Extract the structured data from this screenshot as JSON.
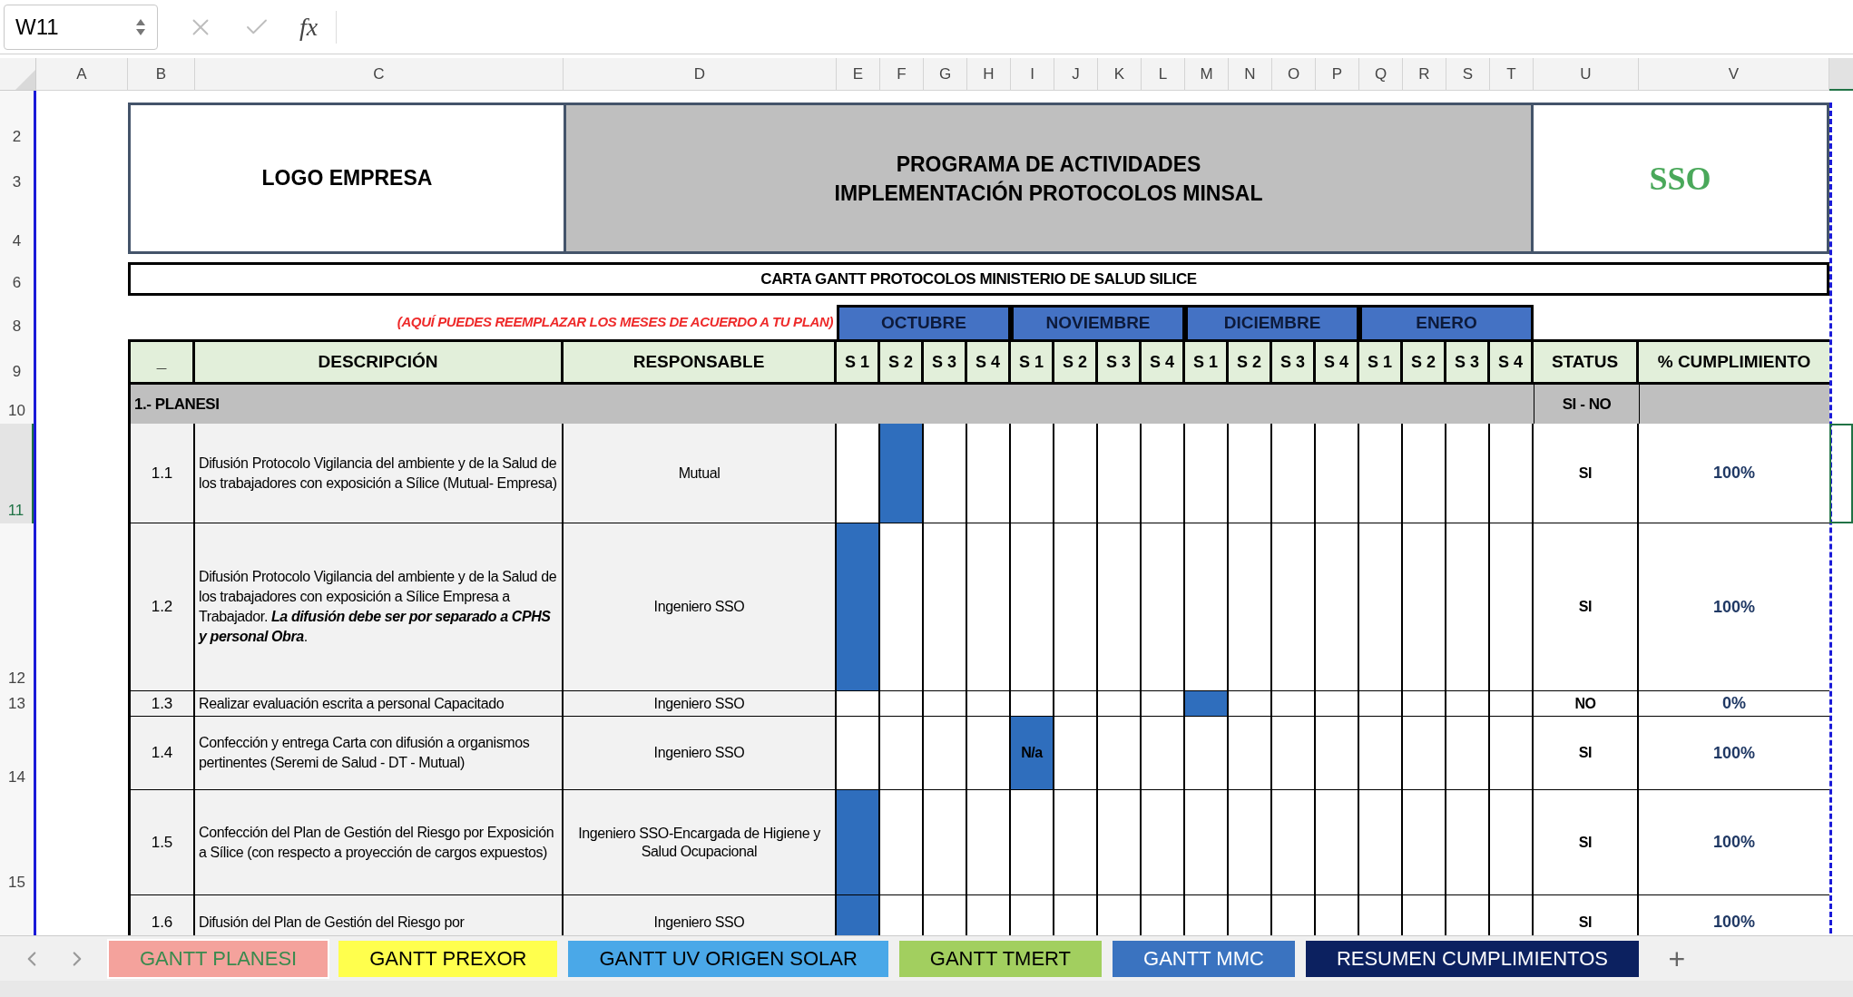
{
  "formula_bar": {
    "name_box": "W11",
    "function_label": "fx"
  },
  "columns": [
    {
      "label": "A"
    },
    {
      "label": "B"
    },
    {
      "label": "C"
    },
    {
      "label": "D"
    },
    {
      "label": "E"
    },
    {
      "label": "F"
    },
    {
      "label": "G"
    },
    {
      "label": "H"
    },
    {
      "label": "I"
    },
    {
      "label": "J"
    },
    {
      "label": "K"
    },
    {
      "label": "L"
    },
    {
      "label": "M"
    },
    {
      "label": "N"
    },
    {
      "label": "O"
    },
    {
      "label": "P"
    },
    {
      "label": "Q"
    },
    {
      "label": "R"
    },
    {
      "label": "S"
    },
    {
      "label": "T"
    },
    {
      "label": "U"
    },
    {
      "label": "V"
    }
  ],
  "row_headers": [
    {
      "label": "2",
      "selected": false
    },
    {
      "label": "3",
      "selected": false
    },
    {
      "label": "4",
      "selected": false
    },
    {
      "label": "6",
      "selected": false
    },
    {
      "label": "8",
      "selected": false
    },
    {
      "label": "9",
      "selected": false
    },
    {
      "label": "10",
      "selected": false
    },
    {
      "label": "11",
      "selected": true
    },
    {
      "label": "12",
      "selected": false
    },
    {
      "label": "13",
      "selected": false
    },
    {
      "label": "14",
      "selected": false
    },
    {
      "label": "15",
      "selected": false
    }
  ],
  "header": {
    "logo": "LOGO EMPRESA",
    "title_lines": [
      "PROGRAMA DE ACTIVIDADES",
      "IMPLEMENTACIÓN PROTOCOLOS MINSAL"
    ],
    "badge": "SSO"
  },
  "chart_title": "CARTA GANTT PROTOCOLOS MINISTERIO DE SALUD SILICE",
  "note": "(AQUÍ PUEDES REEMPLAZAR LOS MESES DE ACUERDO A TU PLAN)",
  "months": [
    "OCTUBRE",
    "NOVIEMBRE",
    "DICIEMBRE",
    "ENERO"
  ],
  "table": {
    "columns": [
      "_",
      "DESCRIPCIÓN",
      "RESPONSABLE"
    ],
    "weeks": [
      "S 1",
      "S 2",
      "S 3",
      "S 4",
      "S 1",
      "S 2",
      "S 3",
      "S 4",
      "S 1",
      "S 2",
      "S 3",
      "S 4",
      "S 1",
      "S 2",
      "S 3",
      "S 4"
    ],
    "status_header": "STATUS",
    "compliance_header": "% CUMPLIMIENTO"
  },
  "section": {
    "title": "1.- PLANESI",
    "status_hint": "SI - NO"
  },
  "tasks": [
    {
      "number": "1.1",
      "description": "Difusión Protocolo Vigilancia del ambiente y de la Salud de los trabajadores con exposición a Sílice (Mutual- Empresa)",
      "responsible": "Mutual",
      "status": "SI",
      "compliance": "100%",
      "weeks": [
        {
          "filled": false
        },
        {
          "filled": true
        },
        {
          "filled": false
        },
        {
          "filled": false
        },
        {
          "filled": false
        },
        {
          "filled": false
        },
        {
          "filled": false
        },
        {
          "filled": false
        },
        {
          "filled": false
        },
        {
          "filled": false
        },
        {
          "filled": false
        },
        {
          "filled": false
        },
        {
          "filled": false
        },
        {
          "filled": false
        },
        {
          "filled": false
        },
        {
          "filled": false
        }
      ]
    },
    {
      "number": "1.2",
      "description": "Difusión Protocolo Vigilancia del ambiente y de la Salud de los trabajadores con exposición a Sílice Empresa a Trabajador. **La difusión debe ser por separado a CPHS y personal Obra**.",
      "responsible": "Ingeniero SSO",
      "status": "SI",
      "compliance": "100%",
      "weeks": [
        {
          "filled": true
        },
        {
          "filled": false
        },
        {
          "filled": false
        },
        {
          "filled": false
        },
        {
          "filled": false
        },
        {
          "filled": false
        },
        {
          "filled": false
        },
        {
          "filled": false
        },
        {
          "filled": false
        },
        {
          "filled": false
        },
        {
          "filled": false
        },
        {
          "filled": false
        },
        {
          "filled": false
        },
        {
          "filled": false
        },
        {
          "filled": false
        },
        {
          "filled": false
        }
      ]
    },
    {
      "number": "1.3",
      "description": "Realizar evaluación escrita a personal Capacitado",
      "responsible": "Ingeniero SSO",
      "status": "NO",
      "compliance": "0%",
      "weeks": [
        {
          "filled": false
        },
        {
          "filled": false
        },
        {
          "filled": false
        },
        {
          "filled": false
        },
        {
          "filled": false
        },
        {
          "filled": false
        },
        {
          "filled": false
        },
        {
          "filled": false
        },
        {
          "filled": true
        },
        {
          "filled": false
        },
        {
          "filled": false
        },
        {
          "filled": false
        },
        {
          "filled": false
        },
        {
          "filled": false
        },
        {
          "filled": false
        },
        {
          "filled": false
        }
      ]
    },
    {
      "number": "1.4",
      "description": "Confección y entrega Carta con difusión a organismos pertinentes (Seremi de Salud - DT - Mutual)",
      "responsible": "Ingeniero SSO",
      "status": "SI",
      "compliance": "100%",
      "weeks": [
        {
          "filled": false
        },
        {
          "filled": false
        },
        {
          "filled": false
        },
        {
          "filled": false
        },
        {
          "filled": true,
          "text": "N/a"
        },
        {
          "filled": false
        },
        {
          "filled": false
        },
        {
          "filled": false
        },
        {
          "filled": false
        },
        {
          "filled": false
        },
        {
          "filled": false
        },
        {
          "filled": false
        },
        {
          "filled": false
        },
        {
          "filled": false
        },
        {
          "filled": false
        },
        {
          "filled": false
        }
      ]
    },
    {
      "number": "1.5",
      "description": "Confección del Plan de Gestión del Riesgo por Exposición a Sílice (con respecto a proyección de cargos expuestos)",
      "responsible": "Ingeniero SSO-Encargada de Higiene y Salud Ocupacional",
      "status": "SI",
      "compliance": "100%",
      "weeks": [
        {
          "filled": true
        },
        {
          "filled": false
        },
        {
          "filled": false
        },
        {
          "filled": false
        },
        {
          "filled": false
        },
        {
          "filled": false
        },
        {
          "filled": false
        },
        {
          "filled": false
        },
        {
          "filled": false
        },
        {
          "filled": false
        },
        {
          "filled": false
        },
        {
          "filled": false
        },
        {
          "filled": false
        },
        {
          "filled": false
        },
        {
          "filled": false
        },
        {
          "filled": false
        }
      ]
    },
    {
      "number": "1.6",
      "description": "Difusión del Plan de Gestión del Riesgo por",
      "responsible": "Ingeniero SSO",
      "status": "SI",
      "compliance": "100%",
      "weeks": [
        {
          "filled": true
        },
        {
          "filled": false
        },
        {
          "filled": false
        },
        {
          "filled": false
        },
        {
          "filled": false
        },
        {
          "filled": false
        },
        {
          "filled": false
        },
        {
          "filled": false
        },
        {
          "filled": false
        },
        {
          "filled": false
        },
        {
          "filled": false
        },
        {
          "filled": false
        },
        {
          "filled": false
        },
        {
          "filled": false
        },
        {
          "filled": false
        },
        {
          "filled": false
        }
      ]
    }
  ],
  "sheet_tabs": [
    {
      "label": "GANTT PLANESI",
      "color": "#f4a29c",
      "selected": true
    },
    {
      "label": "GANTT PREXOR",
      "color": "#ffff4d",
      "selected": false
    },
    {
      "label": "GANTT UV ORIGEN SOLAR",
      "color": "#4aa8e8",
      "selected": false
    },
    {
      "label": "GANTT TMERT",
      "color": "#a2cf5f",
      "selected": false
    },
    {
      "label": "GANTT MMC",
      "color": "#3a73c0",
      "selected": false
    },
    {
      "label": "RESUMEN CUMPLIMIENTOS",
      "color": "#0c2160",
      "selected": false
    }
  ],
  "add_sheet": "+"
}
